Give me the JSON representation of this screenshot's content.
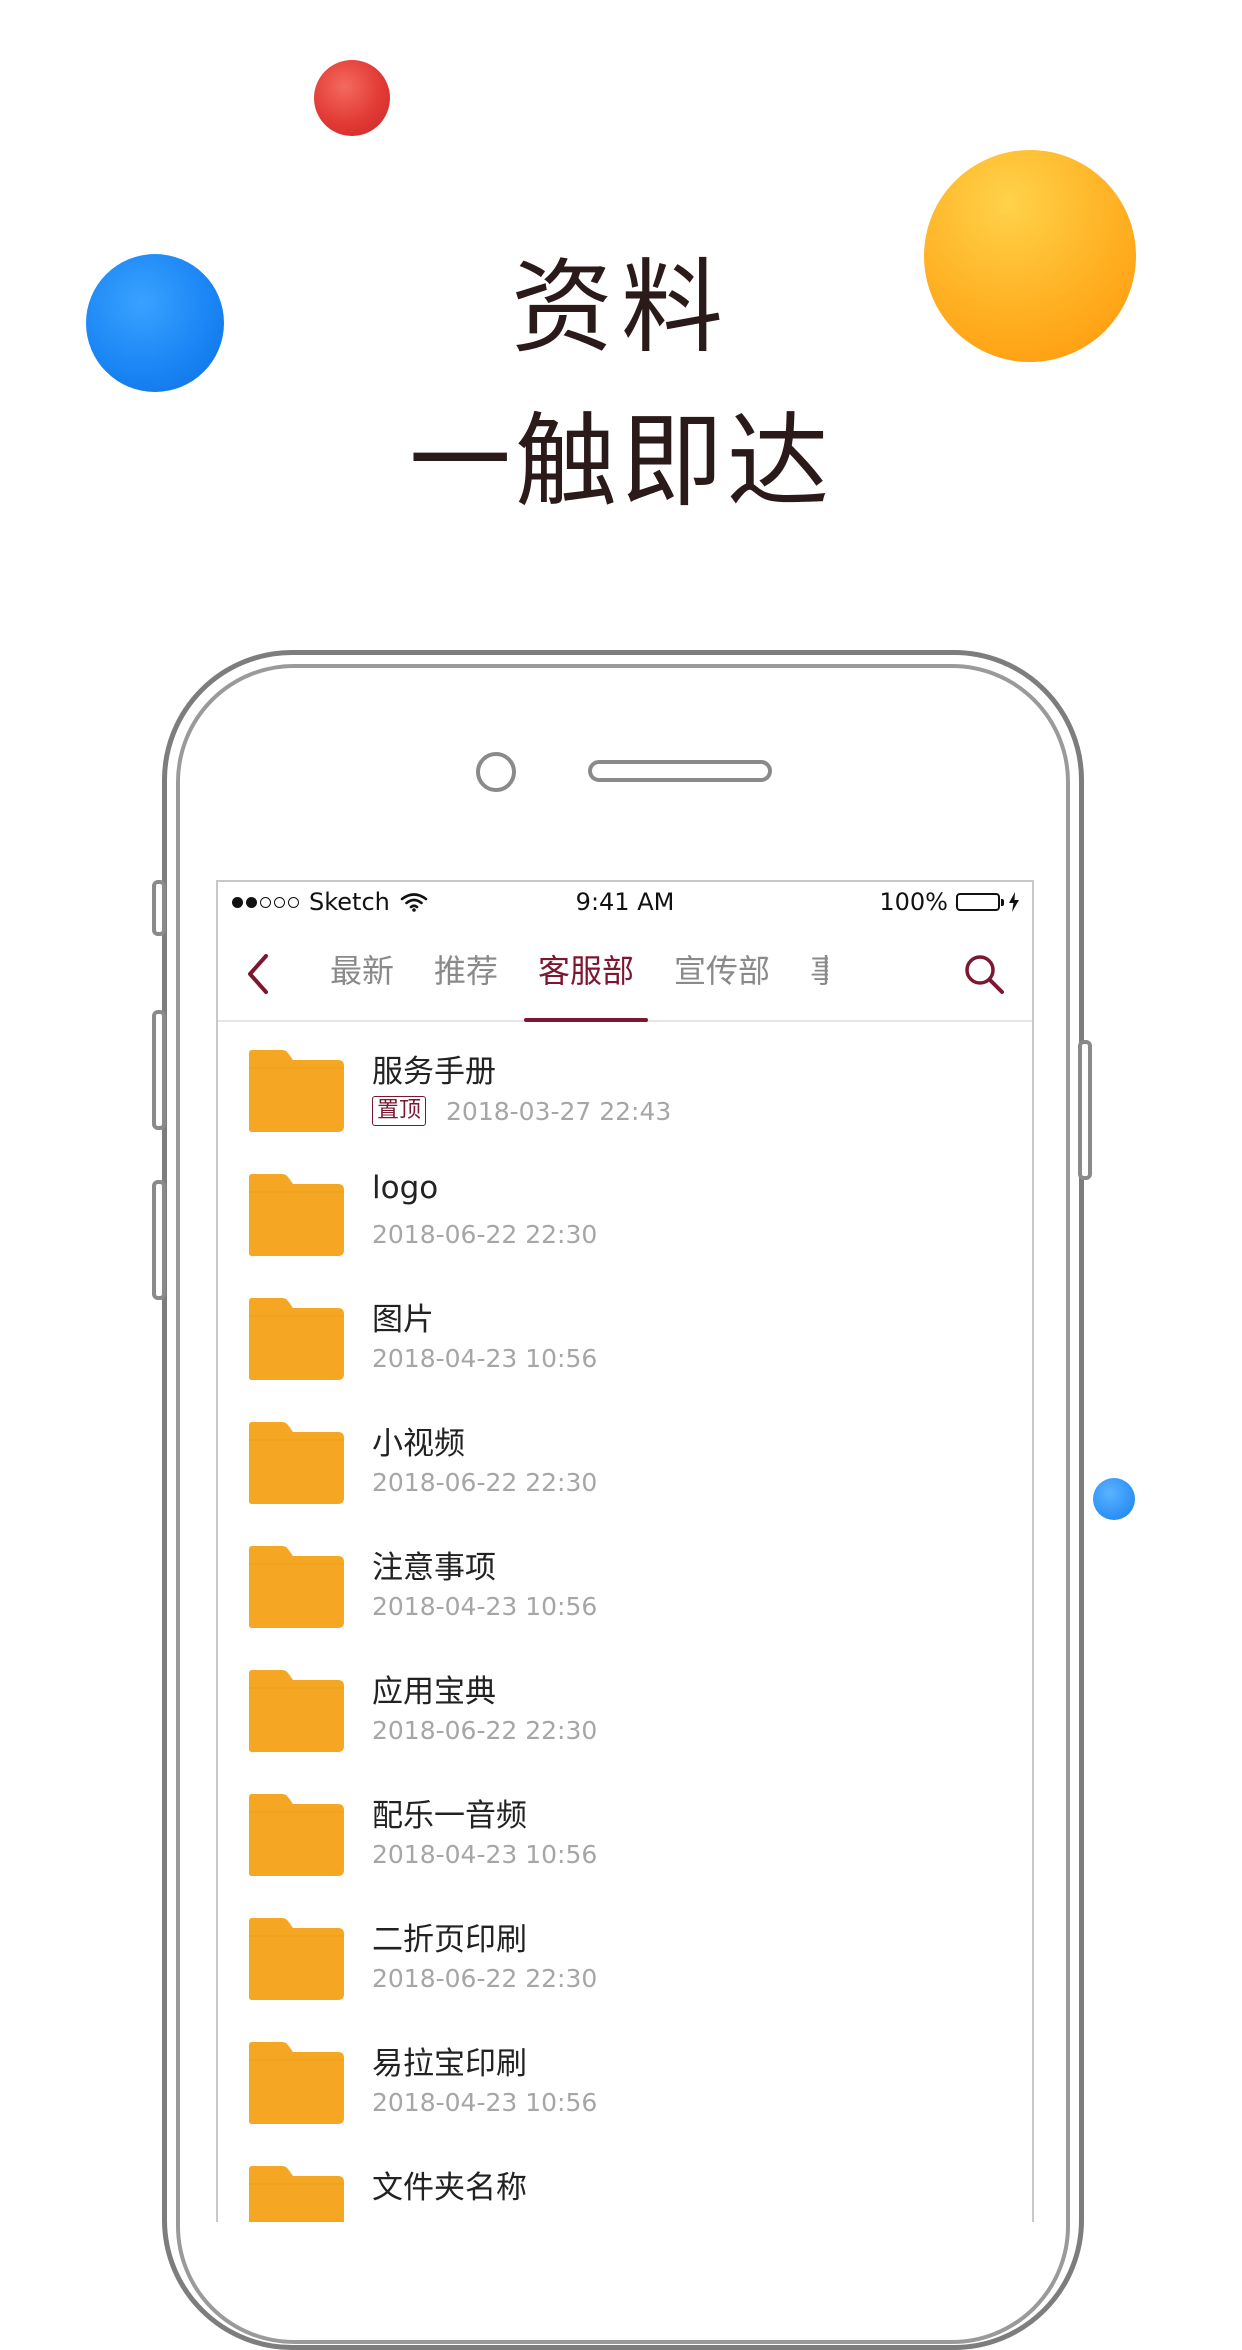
{
  "headline": {
    "line1": "资料",
    "line2": "一触即达"
  },
  "colors": {
    "accent": "#7d1731",
    "folder": "#f5a623",
    "ball_red": "#e23a35",
    "ball_blue": "#1b86f5",
    "ball_orange": "#ffad1f"
  },
  "status_bar": {
    "carrier": "Sketch",
    "time": "9:41 AM",
    "battery": "100%"
  },
  "nav": {
    "back_icon": "chevron-left-icon",
    "search_icon": "search-icon",
    "tabs": [
      {
        "label": "最新"
      },
      {
        "label": "推荐"
      },
      {
        "label": "客服部",
        "active": true
      },
      {
        "label": "宣传部"
      },
      {
        "label": "事"
      }
    ]
  },
  "files": [
    {
      "name": "服务手册",
      "date": "2018-03-27 22:43",
      "badge": "置顶"
    },
    {
      "name": "logo",
      "date": "2018-06-22 22:30"
    },
    {
      "name": "图片",
      "date": "2018-04-23 10:56"
    },
    {
      "name": "小视频",
      "date": "2018-06-22 22:30"
    },
    {
      "name": "注意事项",
      "date": "2018-04-23 10:56"
    },
    {
      "name": "应用宝典",
      "date": "2018-06-22 22:30"
    },
    {
      "name": "配乐一音频",
      "date": "2018-04-23 10:56"
    },
    {
      "name": "二折页印刷",
      "date": "2018-06-22 22:30"
    },
    {
      "name": "易拉宝印刷",
      "date": "2018-04-23 10:56"
    },
    {
      "name": "文件夹名称",
      "date": ""
    }
  ]
}
